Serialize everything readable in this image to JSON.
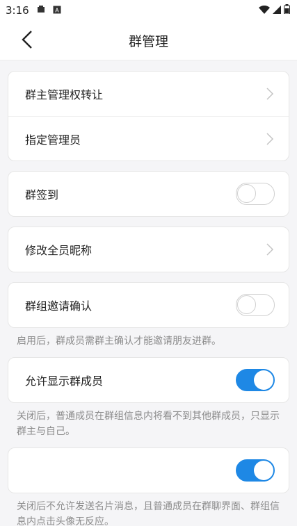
{
  "status_bar": {
    "time": "3:16"
  },
  "header": {
    "title": "群管理"
  },
  "groups": {
    "transfer": {
      "label": "群主管理权转让"
    },
    "assign_admin": {
      "label": "指定管理员"
    },
    "checkin": {
      "label": "群签到",
      "enabled": false
    },
    "rename_all": {
      "label": "修改全员昵称"
    },
    "invite_confirm": {
      "label": "群组邀请确认",
      "enabled": false,
      "note": "启用后，群成员需群主确认才能邀请朋友进群。"
    },
    "show_members": {
      "label": "允许显示群成员",
      "enabled": true,
      "note": "关闭后，普通成员在群组信息内将看不到其他群成员，只显示群主与自己。"
    },
    "card_messages": {
      "label": "",
      "enabled": true,
      "note": "关闭后不允许发送名片消息，且普通成员在群聊界面、群组信息内点击头像无反应。"
    }
  },
  "colors": {
    "accent": "#1e88e5"
  }
}
